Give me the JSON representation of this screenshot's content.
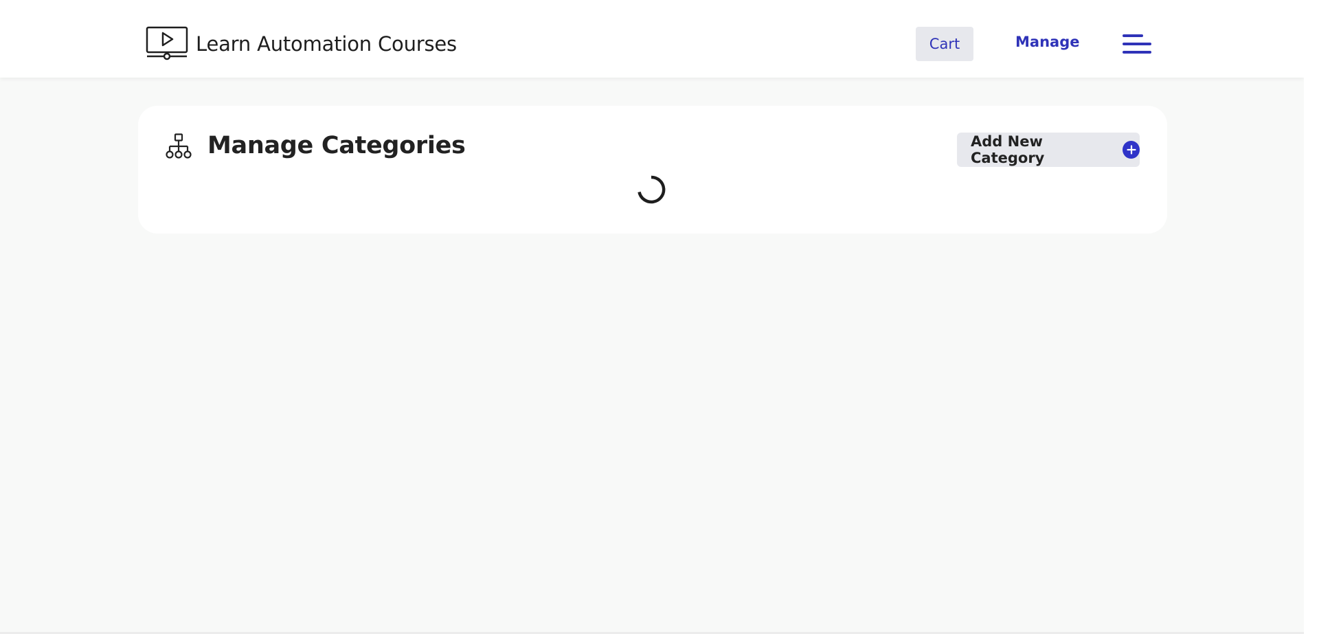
{
  "header": {
    "brand_title": "Learn Automation Courses",
    "brand_icon": "video-player-icon",
    "cart_label": "Cart",
    "manage_label": "Manage",
    "menu_icon": "hamburger-menu-icon"
  },
  "main": {
    "title": "Manage Categories",
    "title_icon": "sitemap-hierarchy-icon",
    "add_button_label": "Add New Category",
    "add_button_icon": "plus-circle-icon",
    "loading": true
  },
  "colors": {
    "accent": "#2f33b8",
    "button_bg": "#e7e8ed",
    "page_bg": "#f8f9f8",
    "text": "#222222"
  }
}
